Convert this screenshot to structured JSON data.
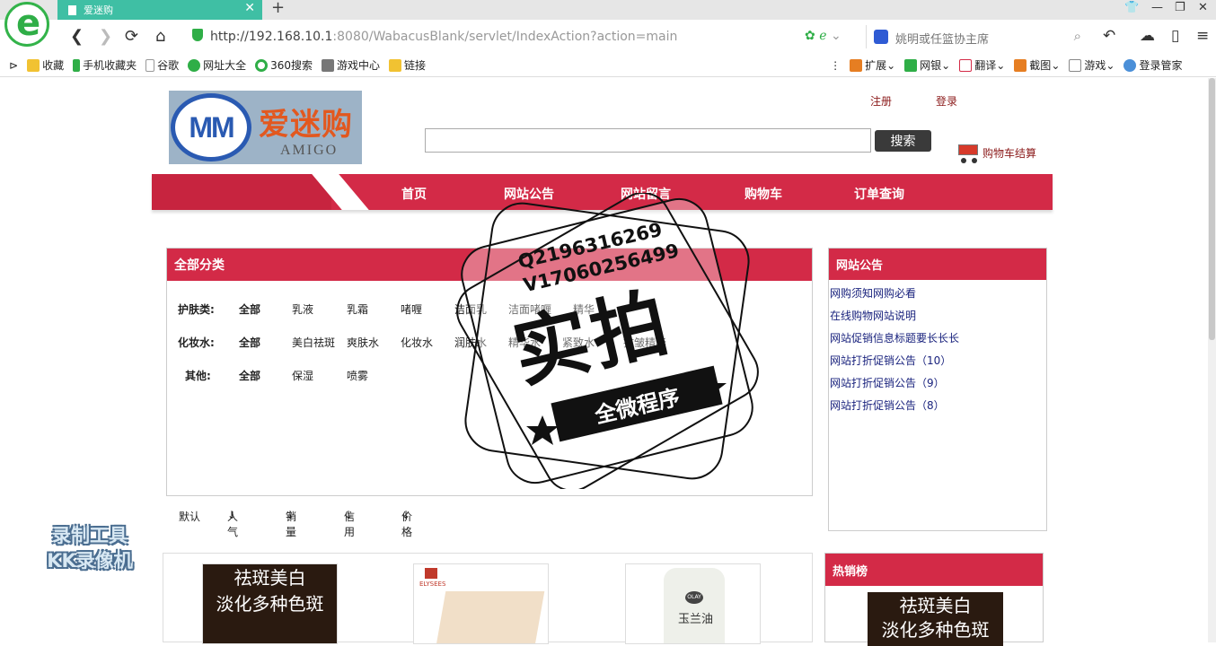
{
  "browser": {
    "tab_title": "爱迷购",
    "url_host": "http://192.168.10.1",
    "url_rest": ":8080/WabacusBlank/servlet/IndexAction?action=main",
    "search_placeholder": "姚明或任篮协主席",
    "bookmarks": [
      "收藏",
      "手机收藏夹",
      "谷歌",
      "网址大全",
      "360搜索",
      "游戏中心",
      "链接"
    ],
    "tools": [
      "扩展",
      "网银",
      "翻译",
      "截图",
      "游戏",
      "登录管家"
    ]
  },
  "logo": {
    "badge": "MM",
    "cn": "爱迷购",
    "en": "AMIGO"
  },
  "header": {
    "register": "注册",
    "login": "登录",
    "search_button": "搜索",
    "cart_label": "购物车结算",
    "search_value": ""
  },
  "nav": [
    "首页",
    "网站公告",
    "网站留言",
    "购物车",
    "订单查询"
  ],
  "categories": {
    "title": "全部分类",
    "rows": [
      {
        "label": "护肤类:",
        "items": [
          "全部",
          "乳液",
          "乳霜",
          "啫喱",
          "洁面乳",
          "洁面啫喱",
          "精华"
        ]
      },
      {
        "label": "化妆水:",
        "items": [
          "全部",
          "美白祛斑",
          "爽肤水",
          "化妆水",
          "润肤水",
          "精华水",
          "紧致水",
          "抗皱精华"
        ]
      },
      {
        "label": "其他:",
        "items": [
          "全部",
          "保湿",
          "喷雾"
        ]
      }
    ]
  },
  "sort": [
    "默认",
    "人气",
    "销量",
    "信用",
    "价格"
  ],
  "notice": {
    "title": "网站公告",
    "items": [
      "网购须知网购必看",
      "在线购物网站说明",
      "网站促销信息标题要长长长",
      "网站打折促销公告（10）",
      "网站打折促销公告（9）",
      "网站打折促销公告（8）"
    ]
  },
  "products": {
    "promo_text_1": "祛斑美白",
    "promo_text_2": "淡化多种色斑",
    "brand_2": "ELYSEES",
    "brand_3": "OLAY",
    "brand_3_cn": "玉兰油"
  },
  "hot": {
    "title": "热销榜",
    "text_1": "祛斑美白",
    "text_2": "淡化多种色斑"
  },
  "overlay": {
    "watermark_line1": "录制工具",
    "watermark_line2": "KK录像机",
    "stamp_q": "Q2196316269",
    "stamp_v": "V17060256499",
    "stamp_big": "实拍",
    "stamp_ribbon": "全微程序"
  },
  "colors": {
    "brand_red": "#d32a47",
    "tab_teal": "#3fbfa4",
    "link_blue": "#1a237e"
  }
}
